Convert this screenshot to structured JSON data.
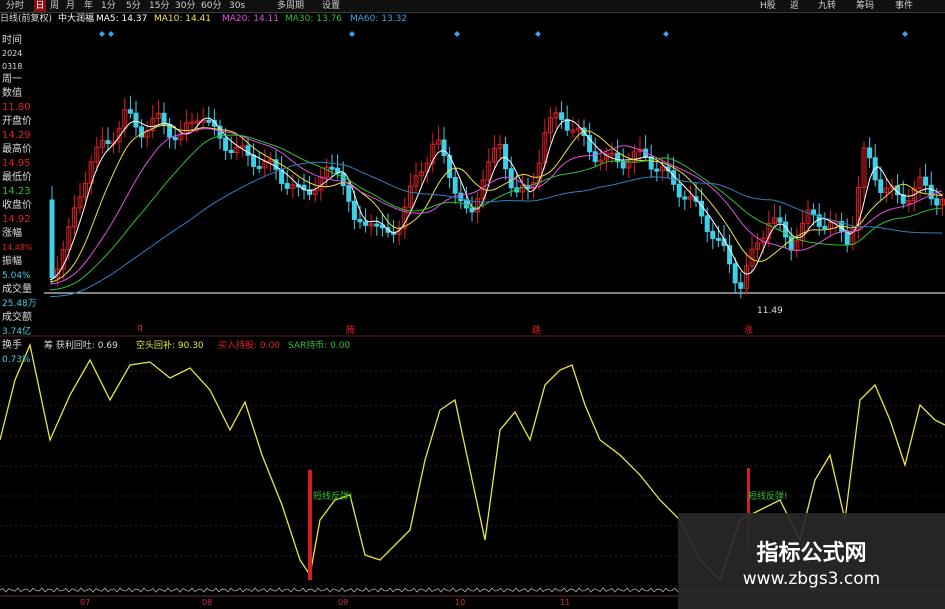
{
  "toolbar": {
    "left_buttons": [
      "分时",
      "日",
      "周",
      "月",
      "年",
      "1分",
      "5分",
      "15分",
      "30分",
      "60分",
      "30s",
      "多周期",
      "设置"
    ],
    "active_index": 1,
    "right_buttons": [
      "H股",
      "返",
      "九转",
      "筹码",
      "事件"
    ]
  },
  "ma_row": {
    "chart_label": "日线(前复权)",
    "stock_name": "中大润福",
    "ma5": "MA5: 14.37",
    "ma10": "MA10: 14.41",
    "ma20": "MA20: 14.11",
    "ma30": "MA30: 13.76",
    "ma60": "MA60: 13.32"
  },
  "sidebar": {
    "time_label": "时间",
    "year": "2024",
    "date": "0318",
    "weekday": "周一",
    "value_label": "数值",
    "value": "11.80",
    "open_label": "开盘价",
    "open": "14.29",
    "high_label": "最高价",
    "high": "14.95",
    "low_label": "最低价",
    "low": "14.23",
    "close_label": "收盘价",
    "close": "14.92",
    "change_label": "涨幅",
    "change": "14.48%",
    "amplitude_label": "振幅",
    "amplitude": "5.04%",
    "volume_label": "成交量",
    "volume": "25.48万",
    "amount_label": "成交额",
    "amount": "3.74亿",
    "turnover_label": "换手",
    "turnover": "0.73%"
  },
  "main_chart": {
    "low_marker": "11.49",
    "signals": [
      "q",
      "腾",
      "跳",
      "涨"
    ]
  },
  "indicator": {
    "name": "筹 获利回吐: 0.69",
    "long_short": "空头回补: 90.30",
    "buy": "买入持股: 0.00",
    "sar": "SAR持币: 0.00",
    "annot": "短线反弹!"
  },
  "x_axis": [
    "07",
    "08",
    "09",
    "10",
    "11"
  ],
  "watermark": {
    "title": "指标公式网",
    "url": "www.zbgs3.com"
  },
  "colors": {
    "up": "#e02020",
    "down": "#3fd0e8",
    "ma5": "#ffffff",
    "ma10": "#f0e040",
    "ma20": "#e050e0",
    "ma30": "#30c030",
    "ma60": "#3080c0",
    "indicator_line": "#e8e840"
  }
}
